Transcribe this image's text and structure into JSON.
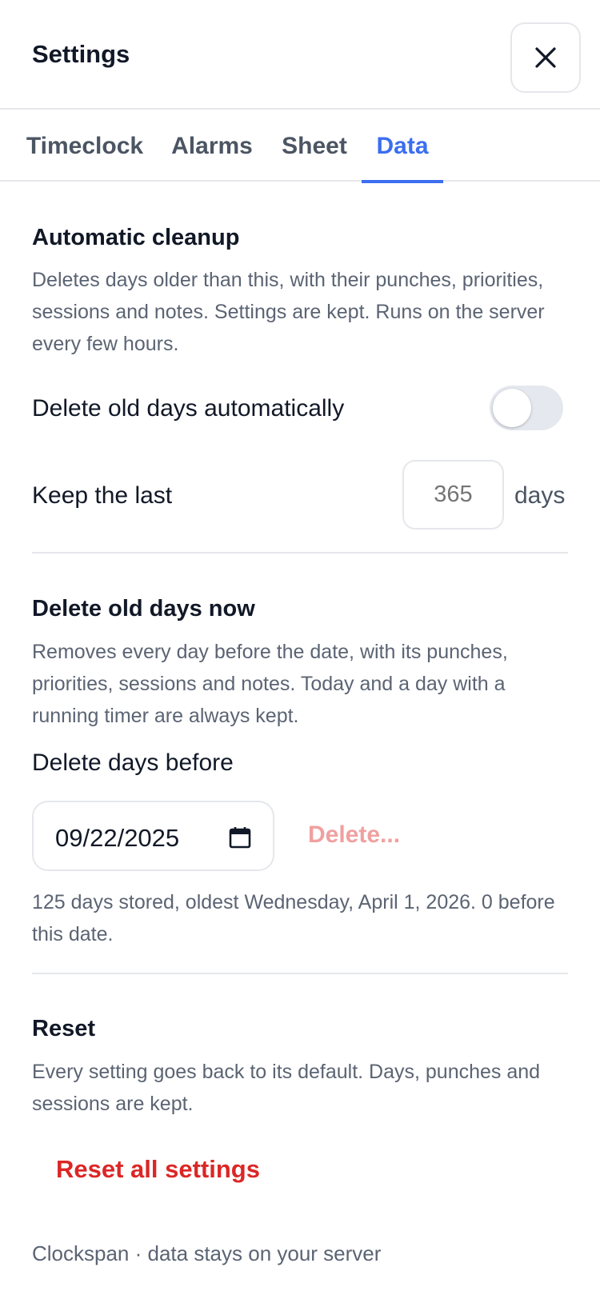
{
  "header": {
    "title": "Settings",
    "close_icon": "close-icon"
  },
  "tabs": [
    {
      "label": "Timeclock",
      "active": false
    },
    {
      "label": "Alarms",
      "active": false
    },
    {
      "label": "Sheet",
      "active": false
    },
    {
      "label": "Data",
      "active": true
    }
  ],
  "auto_cleanup": {
    "title": "Automatic cleanup",
    "description": "Deletes days older than this, with their punches, priorities, sessions and notes. Settings are kept. Runs on the server every few hours.",
    "toggle_label": "Delete old days automatically",
    "toggle_on": false,
    "keep_label": "Keep the last",
    "keep_placeholder": "365",
    "keep_unit": "days"
  },
  "delete_now": {
    "title": "Delete old days now",
    "description": "Removes every day before the date, with its punches, priorities, sessions and notes. Today and a day with a running timer are always kept.",
    "date_label": "Delete days before",
    "date_value": "09/22/2025",
    "delete_button": "Delete...",
    "status": "125 days stored, oldest Wednesday, April 1, 2026. 0 before this date."
  },
  "reset": {
    "title": "Reset",
    "description": "Every setting goes back to its default. Days, punches and sessions are kept.",
    "button": "Reset all settings"
  },
  "footer": {
    "text": "Clockspan · data stays on your server"
  },
  "colors": {
    "accent": "#3b6ef0",
    "danger": "#dc2626",
    "danger_disabled": "#f0a0a0"
  }
}
